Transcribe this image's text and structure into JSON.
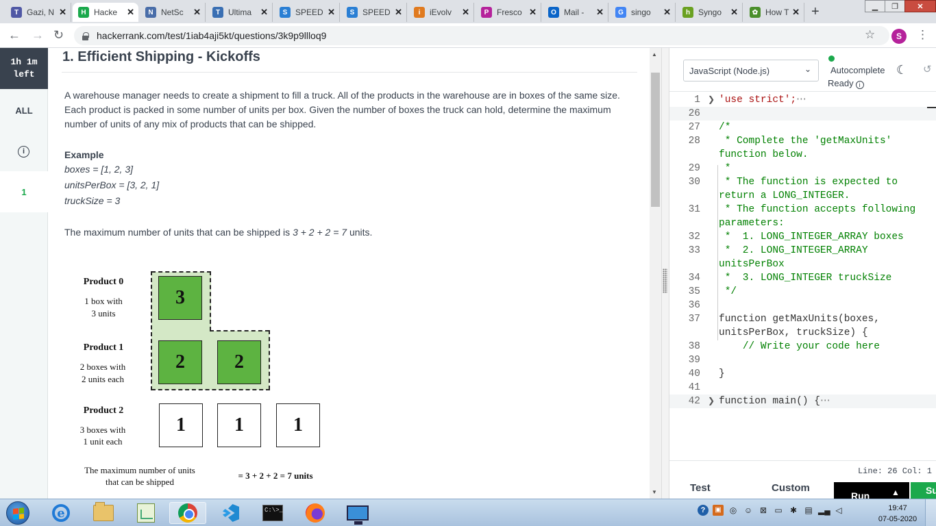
{
  "browser": {
    "tabs": [
      {
        "label": "Gazi, N",
        "favicon_color": "#5058a5",
        "favicon_glyph": "T"
      },
      {
        "label": "Hacke",
        "favicon_color": "#1ba94c",
        "favicon_glyph": "H",
        "active": true
      },
      {
        "label": "NetSc",
        "favicon_color": "#4a6ea9",
        "favicon_glyph": "N"
      },
      {
        "label": "Ultima",
        "favicon_color": "#3a6fb3",
        "favicon_glyph": "T"
      },
      {
        "label": "SPEED",
        "favicon_color": "#2a7fd4",
        "favicon_glyph": "S"
      },
      {
        "label": "SPEED",
        "favicon_color": "#2a7fd4",
        "favicon_glyph": "S"
      },
      {
        "label": "iEvolv",
        "favicon_color": "#e07a1f",
        "favicon_glyph": "i"
      },
      {
        "label": "Fresco",
        "favicon_color": "#b5229b",
        "favicon_glyph": "P"
      },
      {
        "label": "Mail -",
        "favicon_color": "#0a64c8",
        "favicon_glyph": "O"
      },
      {
        "label": "singo",
        "favicon_color": "#4285f4",
        "favicon_glyph": "G"
      },
      {
        "label": "Syngo",
        "favicon_color": "#6aa121",
        "favicon_glyph": "h"
      },
      {
        "label": "How T",
        "favicon_color": "#4a8f2a",
        "favicon_glyph": "✿"
      }
    ],
    "url": "hackerrank.com/test/1iab4aji5kt/questions/3k9p9llloq9",
    "profile_initial": "S"
  },
  "rail": {
    "timer_line1": "1h 1m",
    "timer_line2": "left",
    "all_label": "ALL",
    "info_glyph": "i",
    "question_number": "1"
  },
  "problem": {
    "title": "1. Efficient Shipping - Kickoffs",
    "statement": "A warehouse manager needs to create a shipment to fill a truck. All of the products in the warehouse are in boxes of the same size. Each product is packed in some number of units per box. Given the number of boxes the truck can hold, determine the maximum number of units of any mix of products that can be shipped.",
    "example_heading": "Example",
    "example_lines": [
      "boxes = [1, 2, 3]",
      "unitsPerBox = [3, 2, 1]",
      "truckSize = 3"
    ],
    "result_prefix": "The maximum number of units that can be shipped is ",
    "result_expr": "3 + 2 + 2 = 7",
    "result_suffix": " units."
  },
  "diagram": {
    "products": [
      {
        "name": "Product 0",
        "desc_line1": "1 box with",
        "desc_line2": "3 units",
        "boxes": [
          "3"
        ]
      },
      {
        "name": "Product 1",
        "desc_line1": "2 boxes with",
        "desc_line2": "2 units each",
        "boxes": [
          "2",
          "2"
        ]
      },
      {
        "name": "Product 2",
        "desc_line1": "3 boxes with",
        "desc_line2": "1 unit each",
        "boxes": [
          "1",
          "1",
          "1"
        ]
      }
    ],
    "footer_line1": "The maximum number of units",
    "footer_line2": "that can be shipped",
    "footer_result": "= 3 + 2 + 2 = 7 units",
    "selected_color": "#5db341",
    "region_color": "#d4e8c6"
  },
  "editor": {
    "language": "JavaScript (Node.js)",
    "autocomplete_label": "Autocomplete",
    "ready_label": "Ready",
    "status": "Line: 26 Col: 1",
    "tab_test": "Test",
    "tab_custom": "Custom",
    "run_label": "Run",
    "submit_label": "Su",
    "lines": [
      {
        "n": "1",
        "text": "'use strict';",
        "folded": true
      },
      {
        "n": "26",
        "text": ""
      },
      {
        "n": "27",
        "text": "/*"
      },
      {
        "n": "28",
        "text": " * Complete the 'getMaxUnits' function below."
      },
      {
        "n": "29",
        "text": " *"
      },
      {
        "n": "30",
        "text": " * The function is expected to return a LONG_INTEGER."
      },
      {
        "n": "31",
        "text": " * The function accepts following parameters:"
      },
      {
        "n": "32",
        "text": " *  1. LONG_INTEGER_ARRAY boxes"
      },
      {
        "n": "33",
        "text": " *  2. LONG_INTEGER_ARRAY unitsPerBox"
      },
      {
        "n": "34",
        "text": " *  3. LONG_INTEGER truckSize"
      },
      {
        "n": "35",
        "text": " */"
      },
      {
        "n": "36",
        "text": ""
      },
      {
        "n": "37",
        "text": "function getMaxUnits(boxes, unitsPerBox, truckSize) {"
      },
      {
        "n": "38",
        "text": "    // Write your code here"
      },
      {
        "n": "39",
        "text": ""
      },
      {
        "n": "40",
        "text": "}"
      },
      {
        "n": "41",
        "text": ""
      },
      {
        "n": "42",
        "text": "function main() {",
        "folded": true
      }
    ],
    "fold_marker": "⋯"
  },
  "taskbar": {
    "time": "19:47",
    "date": "07-05-2020"
  }
}
